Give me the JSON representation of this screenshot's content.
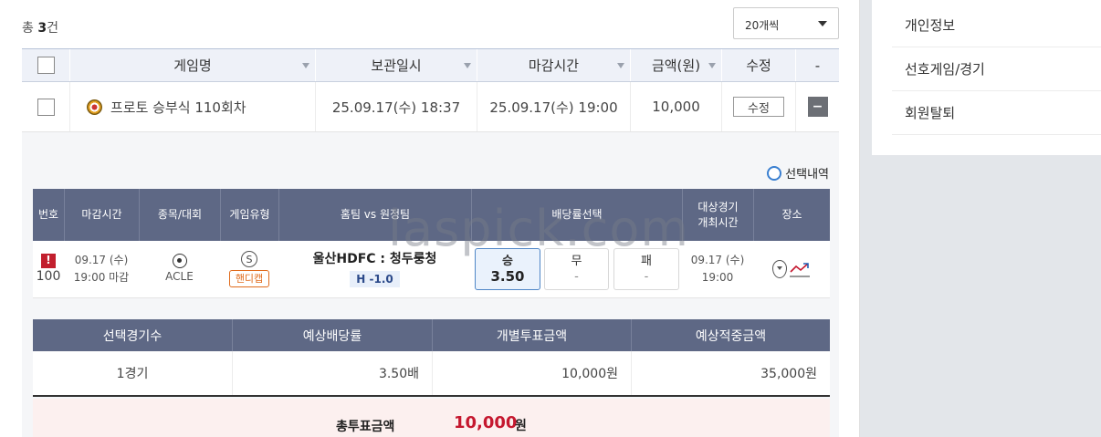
{
  "list": {
    "count_prefix": "총",
    "count_value": "3",
    "count_suffix": "건",
    "page_size_label": "20개씩"
  },
  "table": {
    "headers": [
      "게임명",
      "보관일시",
      "마감시간",
      "금액(원)",
      "수정",
      "-"
    ],
    "row": {
      "game_name": "프로토 승부식 110회차",
      "saved_at": "25.09.17(수) 18:37",
      "deadline": "25.09.17(수) 19:00",
      "amount": "10,000",
      "edit_label": "수정",
      "collapse_symbol": "−"
    }
  },
  "detail": {
    "selection_history_label": "선택내역",
    "headers": {
      "no": "번호",
      "deadline": "마감시간",
      "sport": "종목/대회",
      "game_type": "게임유형",
      "match": "홈팀 vs 원정팀",
      "odds": "배당률선택",
      "match_time": "대상경기\n개최시간",
      "venue": "장소"
    },
    "row": {
      "warn_symbol": "!",
      "number": "100",
      "deadline_date": "09.17 (수)",
      "deadline_time": "19:00 마감",
      "league": "ACLE",
      "game_type_letter": "S",
      "game_type_label": "핸디캡",
      "match": "울산HDFC : 청두룽청",
      "handicap": "H -1.0",
      "odds": [
        {
          "label": "승",
          "value": "3.50",
          "selected": true
        },
        {
          "label": "무",
          "value": "-",
          "selected": false
        },
        {
          "label": "패",
          "value": "-",
          "selected": false
        }
      ],
      "match_date": "09.17 (수)",
      "match_time": "19:00"
    }
  },
  "summary": {
    "headers": [
      "선택경기수",
      "예상배당률",
      "개별투표금액",
      "예상적중금액"
    ],
    "values": [
      "1경기",
      "3.50배",
      "10,000원",
      "35,000원"
    ],
    "total_label": "총투표금액",
    "total_amount": "10,000",
    "total_unit": "원"
  },
  "sidebar": {
    "items": [
      "개인정보",
      "선호게임/경기",
      "회원탈퇴"
    ]
  },
  "watermark": "laspick.com",
  "colors": {
    "header_bg": "#5e6885",
    "accent_red": "#c5182f",
    "handicap_orange": "#e06b1c",
    "selected_odd_border": "#4f86c6"
  }
}
